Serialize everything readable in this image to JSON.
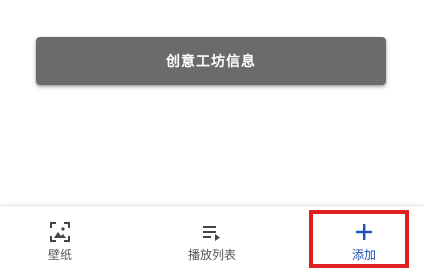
{
  "main": {
    "info_button_label": "创意工坊信息"
  },
  "bottom_nav": {
    "items": [
      {
        "label": "壁纸",
        "icon": "wallpaper-icon"
      },
      {
        "label": "播放列表",
        "icon": "playlist-icon"
      },
      {
        "label": "添加",
        "icon": "add-icon"
      }
    ]
  },
  "colors": {
    "button_bg": "#6b6b6b",
    "accent": "#1e4fb5",
    "highlight": "#e02020"
  }
}
